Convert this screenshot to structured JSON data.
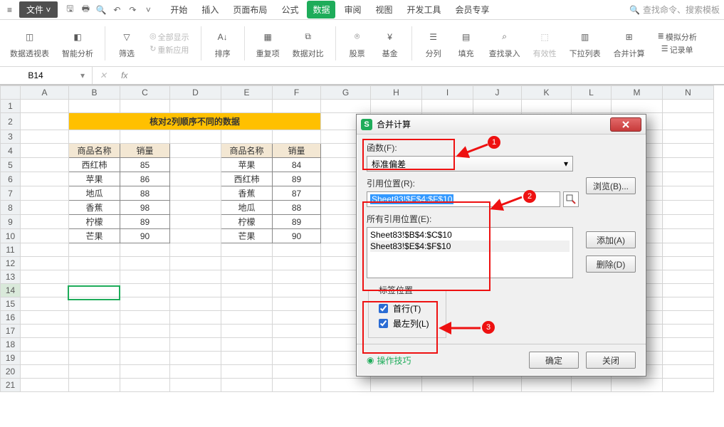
{
  "topbar": {
    "menu_icon": "≡",
    "file_label": "文件",
    "tabs": [
      "开始",
      "插入",
      "页面布局",
      "公式",
      "数据",
      "审阅",
      "视图",
      "开发工具",
      "会员专享"
    ],
    "active_tab_index": 4,
    "search_placeholder": "查找命令、搜索模板"
  },
  "ribbon": {
    "items": [
      {
        "label": "数据透视表",
        "icon": "◫"
      },
      {
        "label": "智能分析",
        "icon": "◧"
      },
      {
        "label": "筛选",
        "icon": "▽",
        "dropdown": true
      },
      {
        "label": "全部显示",
        "icon": "◎",
        "disabled": true,
        "sub": "重新应用"
      },
      {
        "label": "排序",
        "icon": "A↓",
        "dropdown": true
      },
      {
        "label": "重复项",
        "icon": "▦",
        "dropdown": true
      },
      {
        "label": "数据对比",
        "icon": "⧉",
        "dropdown": true
      },
      {
        "label": "股票",
        "icon": "⌾"
      },
      {
        "label": "基金",
        "icon": "¥"
      },
      {
        "label": "分列",
        "icon": "☰",
        "dropdown": true
      },
      {
        "label": "填充",
        "icon": "▤",
        "dropdown": true
      },
      {
        "label": "查找录入",
        "icon": "⌕"
      },
      {
        "label": "有效性",
        "icon": "⬚",
        "dropdown": true,
        "disabled": true
      },
      {
        "label": "下拉列表",
        "icon": "▥"
      },
      {
        "label": "合并计算",
        "icon": "⊞"
      },
      {
        "label": "模拟分析",
        "icon": "≣",
        "sub": "记录单",
        "dropdown": true
      }
    ]
  },
  "addrbar": {
    "cell_ref": "B14",
    "fx": "fx"
  },
  "columns": [
    "A",
    "B",
    "C",
    "D",
    "E",
    "F",
    "G",
    "H",
    "I",
    "J",
    "K",
    "L",
    "M",
    "N"
  ],
  "rows": 21,
  "sheet": {
    "title_text": "核对2列顺序不同的数据",
    "table1_headers": [
      "商品名称",
      "销量"
    ],
    "table1": [
      [
        "西红柿",
        "85"
      ],
      [
        "苹果",
        "86"
      ],
      [
        "地瓜",
        "88"
      ],
      [
        "香蕉",
        "98"
      ],
      [
        "柠檬",
        "89"
      ],
      [
        "芒果",
        "90"
      ]
    ],
    "table2_headers": [
      "商品名称",
      "销量"
    ],
    "table2": [
      [
        "苹果",
        "84"
      ],
      [
        "西红柿",
        "89"
      ],
      [
        "香蕉",
        "87"
      ],
      [
        "地瓜",
        "88"
      ],
      [
        "柠檬",
        "89"
      ],
      [
        "芒果",
        "90"
      ]
    ]
  },
  "dialog": {
    "title": "合并计算",
    "func_label": "函数(F):",
    "func_value": "标准偏差",
    "ref_label": "引用位置(R):",
    "ref_value": "Sheet83!$E$4:$F$10",
    "all_ref_label": "所有引用位置(E):",
    "all_refs": [
      "Sheet83!$B$4:$C$10",
      "Sheet83!$E$4:$F$10"
    ],
    "browse_btn": "浏览(B)...",
    "add_btn": "添加(A)",
    "delete_btn": "删除(D)",
    "label_pos_legend": "标签位置",
    "first_row": "首行(T)",
    "left_col": "最左列(L)",
    "tips": "操作技巧",
    "ok": "确定",
    "close": "关闭"
  },
  "badges": [
    "1",
    "2",
    "3"
  ]
}
